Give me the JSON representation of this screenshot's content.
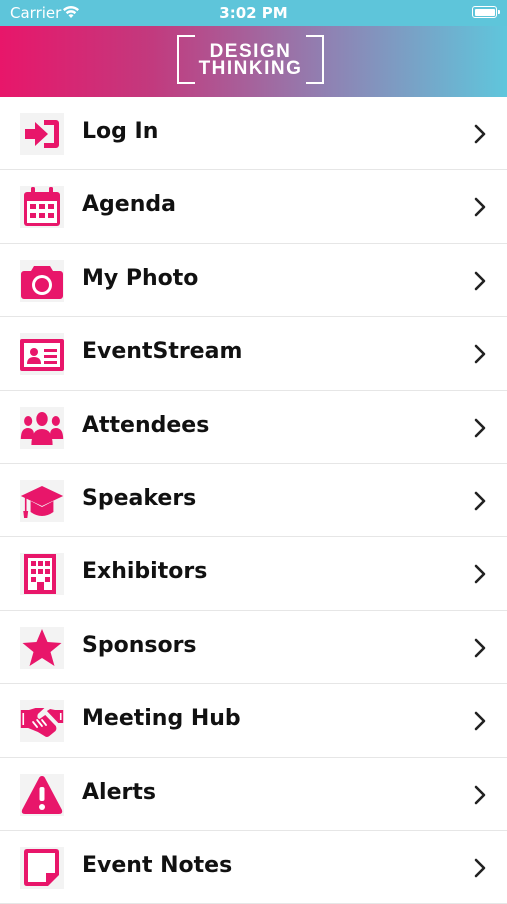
{
  "status_bar": {
    "carrier": "Carrier",
    "time": "3:02 PM"
  },
  "header": {
    "logo_line1": "DESIGN",
    "logo_line2": "THINKING"
  },
  "colors": {
    "accent": "#e8166a",
    "status_bar": "#5ec5da"
  },
  "menu": {
    "items": [
      {
        "label": "Log In",
        "icon": "login-icon"
      },
      {
        "label": "Agenda",
        "icon": "calendar-icon"
      },
      {
        "label": "My Photo",
        "icon": "camera-icon"
      },
      {
        "label": "EventStream",
        "icon": "id-card-icon"
      },
      {
        "label": "Attendees",
        "icon": "users-icon"
      },
      {
        "label": "Speakers",
        "icon": "graduation-cap-icon"
      },
      {
        "label": "Exhibitors",
        "icon": "building-icon"
      },
      {
        "label": "Sponsors",
        "icon": "star-icon"
      },
      {
        "label": "Meeting Hub",
        "icon": "handshake-icon"
      },
      {
        "label": "Alerts",
        "icon": "warning-icon"
      },
      {
        "label": "Event Notes",
        "icon": "note-icon"
      }
    ]
  }
}
